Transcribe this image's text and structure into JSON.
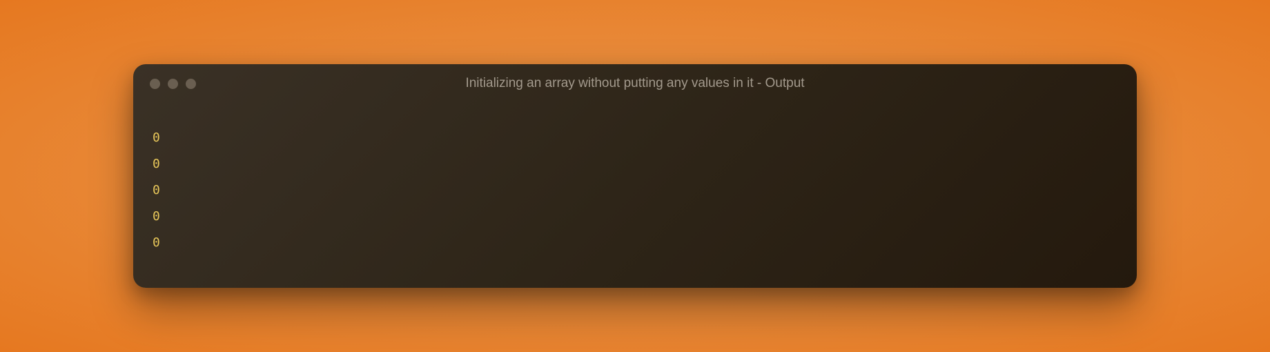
{
  "window": {
    "title": "Initializing an array without putting any values in it - Output"
  },
  "output": {
    "lines": [
      "0",
      "0",
      "0",
      "0",
      "0"
    ]
  }
}
